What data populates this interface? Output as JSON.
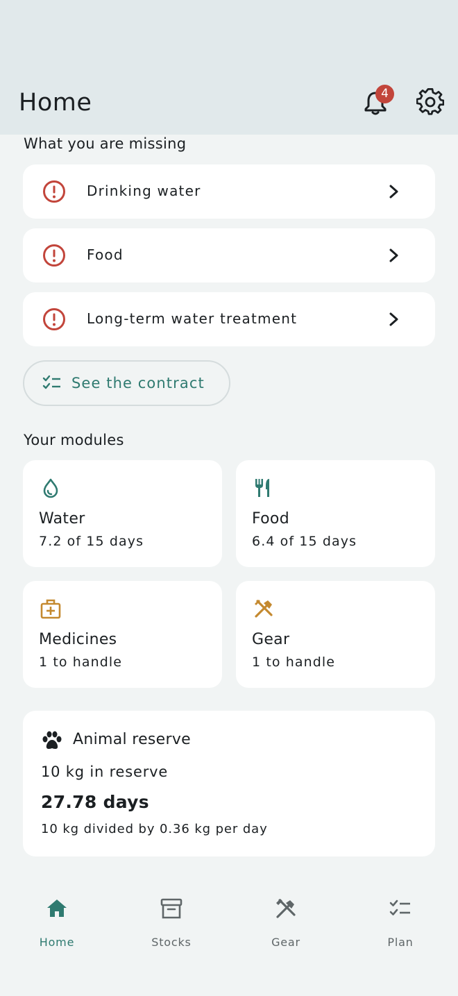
{
  "header": {
    "title": "Home",
    "notification_count": "4"
  },
  "missing": {
    "heading": "What you are missing",
    "items": [
      {
        "label": "Drinking water"
      },
      {
        "label": "Food"
      },
      {
        "label": "Long-term water treatment"
      }
    ],
    "contract_button": "See the contract"
  },
  "modules": {
    "heading": "Your modules",
    "items": [
      {
        "title": "Water",
        "subtitle": "7.2 of 15 days",
        "icon": "water-drop-icon"
      },
      {
        "title": "Food",
        "subtitle": "6.4 of 15 days",
        "icon": "utensils-icon"
      },
      {
        "title": "Medicines",
        "subtitle": "1 to handle",
        "icon": "medical-kit-icon"
      },
      {
        "title": "Gear",
        "subtitle": "1 to handle",
        "icon": "tools-icon"
      }
    ]
  },
  "animal_reserve": {
    "title": "Animal reserve",
    "reserve": "10 kg in reserve",
    "days": "27.78 days",
    "formula": "10 kg divided by 0.36 kg per day"
  },
  "nav": {
    "items": [
      {
        "label": "Home",
        "icon": "home-icon",
        "active": true
      },
      {
        "label": "Stocks",
        "icon": "archive-icon",
        "active": false
      },
      {
        "label": "Gear",
        "icon": "tools-icon",
        "active": false
      },
      {
        "label": "Plan",
        "icon": "checklist-icon",
        "active": false
      }
    ]
  },
  "colors": {
    "accent": "#2f7a70",
    "alert": "#c2453b",
    "warning_icon": "#c4892f",
    "header_bg": "#e1e9eb",
    "page_bg": "#f1f4f4"
  }
}
